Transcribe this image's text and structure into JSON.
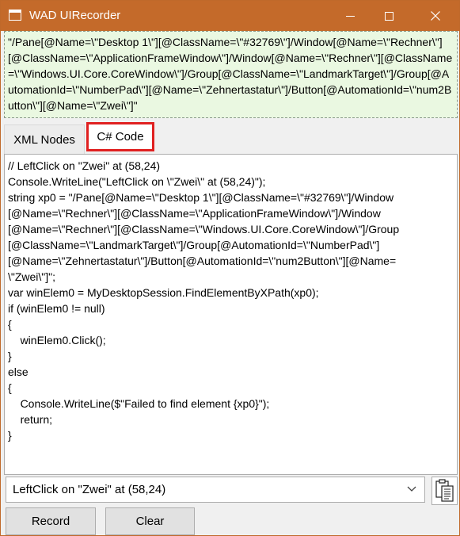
{
  "window": {
    "title": "WAD UIRecorder"
  },
  "xpath": {
    "text": "\"/Pane[@Name=\\\"Desktop 1\\\"][@ClassName=\\\"#32769\\\"]/Window[@Name=\\\"Rechner\\\"][@ClassName=\\\"ApplicationFrameWindow\\\"]/Window[@Name=\\\"Rechner\\\"][@ClassName=\\\"Windows.UI.Core.CoreWindow\\\"]/Group[@ClassName=\\\"LandmarkTarget\\\"]/Group[@AutomationId=\\\"NumberPad\\\"][@Name=\\\"Zehnertastatur\\\"]/Button[@AutomationId=\\\"num2Button\\\"][@Name=\\\"Zwei\\\"]\""
  },
  "tabs": [
    {
      "label": "XML Nodes",
      "selected": false
    },
    {
      "label": "C# Code",
      "selected": true
    }
  ],
  "code": {
    "text": "// LeftClick on \"Zwei\" at (58,24)\nConsole.WriteLine(\"LeftClick on \\\"Zwei\\\" at (58,24)\");\nstring xp0 = \"/Pane[@Name=\\\"Desktop 1\\\"][@ClassName=\\\"#32769\\\"]/Window\n[@Name=\\\"Rechner\\\"][@ClassName=\\\"ApplicationFrameWindow\\\"]/Window\n[@Name=\\\"Rechner\\\"][@ClassName=\\\"Windows.UI.Core.CoreWindow\\\"]/Group\n[@ClassName=\\\"LandmarkTarget\\\"]/Group[@AutomationId=\\\"NumberPad\\\"]\n[@Name=\\\"Zehnertastatur\\\"]/Button[@AutomationId=\\\"num2Button\\\"][@Name=\n\\\"Zwei\\\"]\";\nvar winElem0 = MyDesktopSession.FindElementByXPath(xp0);\nif (winElem0 != null)\n{\n    winElem0.Click();\n}\nelse\n{\n    Console.WriteLine($\"Failed to find element {xp0}\");\n    return;\n}"
  },
  "dropdown": {
    "selected": "LeftClick on \"Zwei\" at (58,24)"
  },
  "buttons": {
    "record": "Record",
    "clear": "Clear"
  },
  "icons": {
    "app": "window-app-icon",
    "clipboard": "clipboard-icon",
    "dropdown": "chevron-down-icon"
  },
  "colors": {
    "titlebar": "#c46a2a",
    "xpath_background": "#eaf8e1",
    "tab_highlight": "#e02020"
  }
}
